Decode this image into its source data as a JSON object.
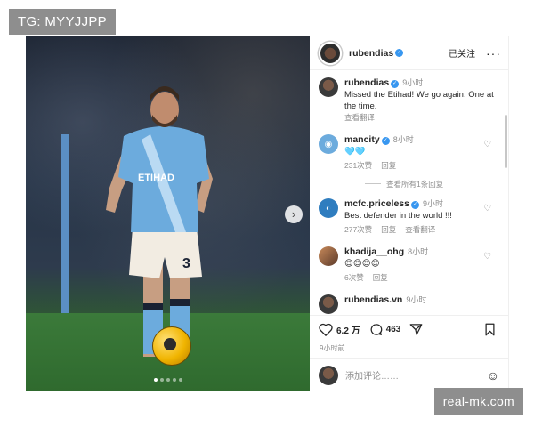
{
  "watermarks": {
    "top_left": "TG: MYYJJPP",
    "bottom_right": "real-mk.com"
  },
  "post": {
    "author": "rubendias",
    "follow_status": "已关注",
    "more": "···",
    "caption": {
      "user": "rubendias",
      "time": "9小时",
      "text": "Missed the Etihad! We go again. One at the time.",
      "translate": "查看翻译"
    },
    "comments": [
      {
        "user": "mancity",
        "verified": true,
        "time": "8小时",
        "text": "🩵🩵",
        "likes": "231次赞",
        "reply": "回复",
        "view_replies": "查看所有1条回复"
      },
      {
        "user": "mcfc.priceless",
        "verified": true,
        "time": "9小时",
        "text": "Best defender in the world !!!",
        "likes": "277次赞",
        "reply": "回复",
        "translate": "查看翻译"
      },
      {
        "user": "khadija__ohg",
        "verified": false,
        "time": "8小时",
        "text": "😍😍😍😍",
        "likes": "6次赞",
        "reply": "回复"
      },
      {
        "user": "rubendias.vn",
        "verified": false,
        "time": "9小时",
        "text": ""
      }
    ],
    "likes_count": "6.2 万",
    "comments_count": "463",
    "posted_time": "9小时前",
    "add_comment_placeholder": "添加评论……",
    "carousel": {
      "total": 5,
      "active": 1
    }
  },
  "icons": [
    "heart-icon",
    "comment-icon",
    "share-icon",
    "bookmark-icon",
    "emoji-icon",
    "verified-badge-icon",
    "next-arrow-icon"
  ],
  "colors": {
    "verified": "#3897f0",
    "muted": "#8e8e8e",
    "text": "#262626"
  }
}
